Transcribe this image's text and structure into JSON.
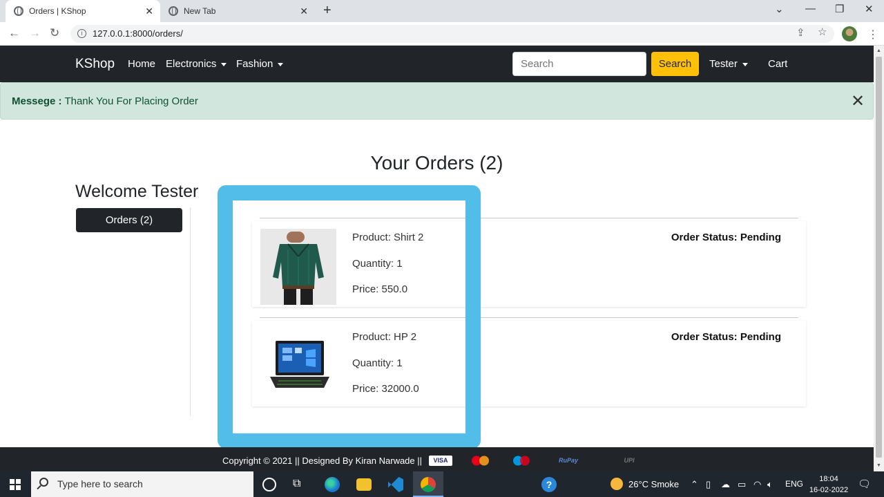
{
  "browser": {
    "tabs": [
      {
        "title": "Orders | KShop",
        "active": true
      },
      {
        "title": "New Tab",
        "active": false
      }
    ],
    "url": "127.0.0.1:8000/orders/"
  },
  "navbar": {
    "brand": "KShop",
    "links": [
      {
        "label": "Home",
        "dropdown": false
      },
      {
        "label": "Electronics",
        "dropdown": true
      },
      {
        "label": "Fashion",
        "dropdown": true
      }
    ],
    "search_placeholder": "Search",
    "search_button": "Search",
    "user_menu": "Tester",
    "cart": "Cart"
  },
  "alert": {
    "label": "Messege :",
    "message": "Thank You For Placing Order"
  },
  "page": {
    "title": "Your Orders (2)",
    "welcome": "Welcome Tester",
    "sidebar_button": "Orders (2)"
  },
  "orders": [
    {
      "product": "Product: Shirt 2",
      "quantity": "Quantity: 1",
      "price": "Price: 550.0",
      "status": "Order Status: Pending",
      "image": "shirt"
    },
    {
      "product": "Product: HP 2",
      "quantity": "Quantity: 1",
      "price": "Price: 32000.0",
      "status": "Order Status: Pending",
      "image": "laptop"
    }
  ],
  "footer": {
    "copyright": "Copyright © 2021 || Designed By Kiran Narwade ||",
    "payment_logos": [
      "VISA",
      "MasterCard",
      "Maestro",
      "RuPay",
      "UPI"
    ]
  },
  "taskbar": {
    "search_placeholder": "Type here to search",
    "weather": "26°C  Smoke",
    "language": "ENG",
    "time": "18:04",
    "date": "16-02-2022"
  },
  "colors": {
    "navbar_bg": "#212529",
    "search_button": "#ffc107",
    "alert_bg": "#d1e7dd",
    "highlight": "#52bde8"
  }
}
